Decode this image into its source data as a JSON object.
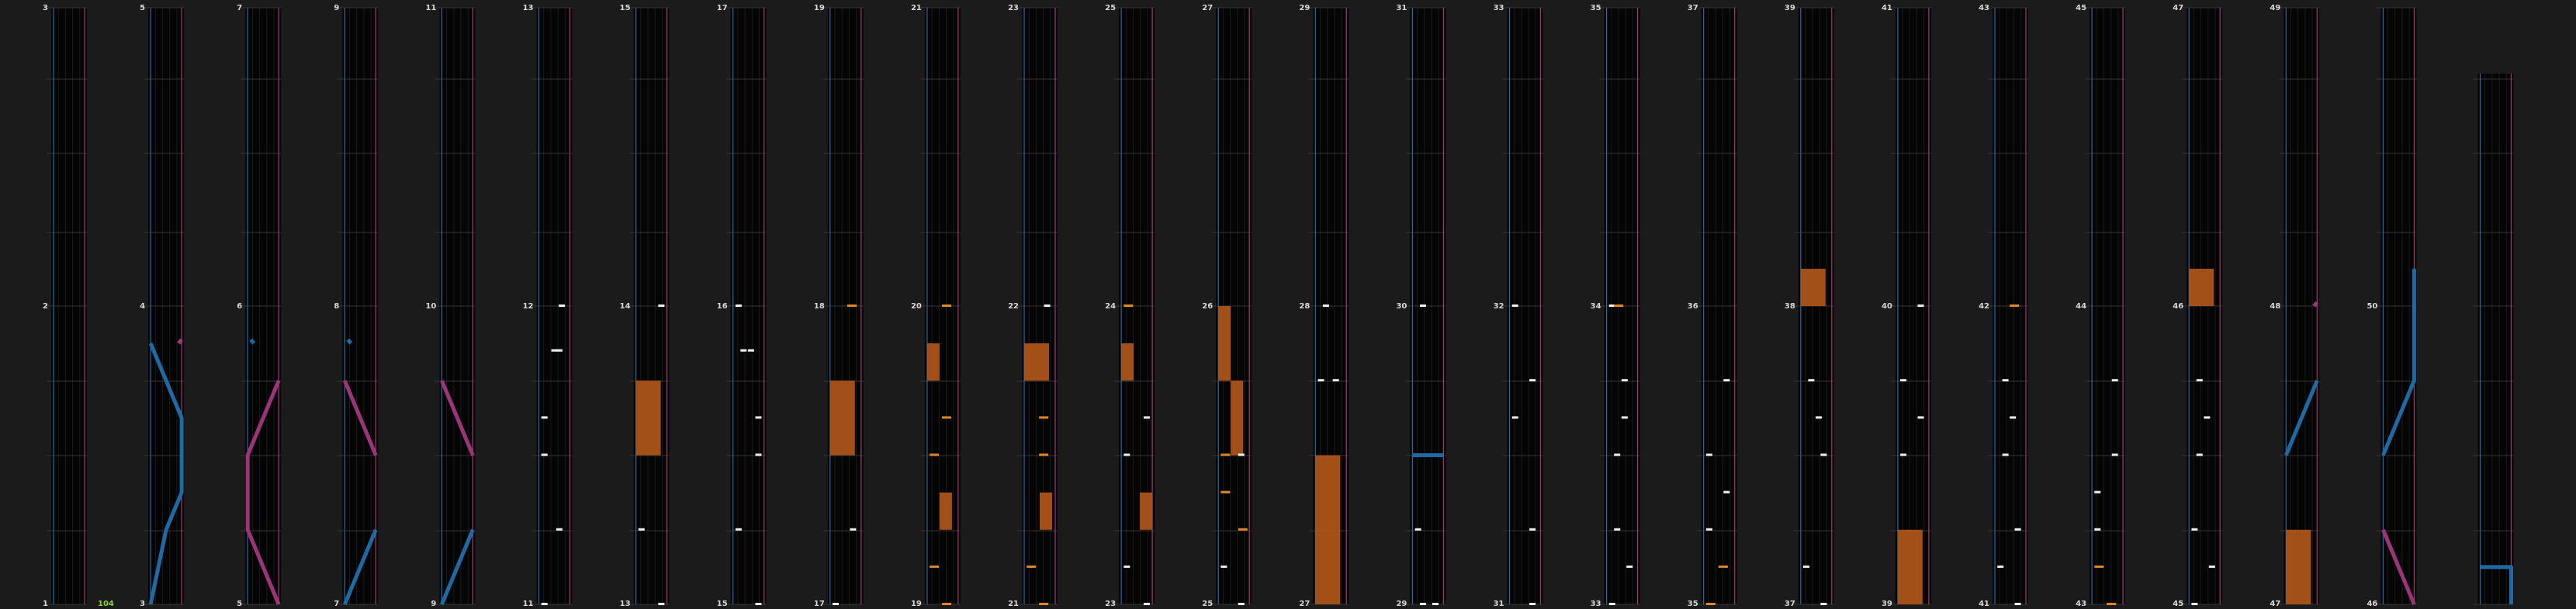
{
  "colors": {
    "background": "#1b1b1b",
    "lane": "#050505",
    "beat_line": "#343434",
    "left_guide": "#2a6aa8",
    "right_guide": "#a83a78",
    "left_slider": "#1f6aa5",
    "right_slider": "#9b3478",
    "hold": "#b0561a",
    "note": "#f0f0f0",
    "mine": "#e08828",
    "label": "#d8d8d8",
    "counter": "#8fd13a"
  },
  "counter_text": "104",
  "row_labels": {
    "bottom": [
      "1",
      "3",
      "5",
      "7",
      "9",
      "11",
      "13",
      "15",
      "17",
      "19",
      "21",
      "23",
      "25",
      "27",
      "29",
      "31",
      "33",
      "35",
      "35",
      "37",
      "39",
      "41",
      "43",
      "45",
      "47",
      "46"
    ],
    "middle": [
      "2",
      "4",
      "6",
      "8",
      "10",
      "12",
      "14",
      "16",
      "18",
      "20",
      "22",
      "24",
      "26",
      "28",
      "30",
      "32",
      "34",
      "36",
      "38",
      "40",
      "42",
      "44",
      "46",
      "48",
      "50"
    ],
    "top": [
      "3",
      "5",
      "7",
      "9",
      "11",
      "13",
      "15",
      "17",
      "19",
      "21",
      "23",
      "25",
      "27",
      "29",
      "31",
      "33",
      "35",
      "37",
      "39",
      "41",
      "43",
      "45",
      "47",
      "49"
    ]
  },
  "chart_data": {
    "type": "other",
    "lane_slots": 5,
    "columns": [
      {
        "label_bottom": "1",
        "label_middle": "2",
        "label_top": "3"
      },
      {
        "label_bottom": "3",
        "label_middle": "4",
        "label_top": "5",
        "left_slider": [
          [
            0,
            0.0
          ],
          [
            1,
            0.25
          ],
          [
            2,
            0.5
          ],
          [
            3,
            1.0
          ],
          [
            4,
            1.0
          ],
          [
            5,
            1.0
          ],
          [
            6,
            0.5
          ],
          [
            7,
            0.0
          ]
        ],
        "right_slider": [
          [
            7,
            0.9
          ],
          [
            7.1,
            1.0
          ]
        ]
      },
      {
        "label_bottom": "5",
        "label_middle": "6",
        "label_top": "7",
        "right_slider": [
          [
            0,
            1.0
          ],
          [
            1,
            0.5
          ],
          [
            2,
            0.0
          ],
          [
            3,
            0.0
          ],
          [
            4,
            0.0
          ],
          [
            5,
            0.5
          ],
          [
            6,
            1.0
          ]
        ],
        "left_slider": [
          [
            7.0,
            0.2
          ],
          [
            7.1,
            0.1
          ]
        ]
      },
      {
        "label_bottom": "7",
        "label_middle": "8",
        "label_top": "9",
        "left_slider": [
          [
            0,
            0.0
          ],
          [
            2,
            1.0
          ]
        ],
        "right_slider": [
          [
            4,
            1.0
          ],
          [
            6,
            0.0
          ]
        ],
        "left_slider2": [
          [
            7.0,
            0.2
          ],
          [
            7.1,
            0.1
          ]
        ]
      },
      {
        "label_bottom": "9",
        "label_middle": "10",
        "label_top": "11",
        "left_slider": [
          [
            0,
            0.0
          ],
          [
            2,
            1.0
          ]
        ],
        "right_slider": [
          [
            4,
            1.0
          ],
          [
            6,
            0.0
          ]
        ]
      },
      {
        "label_bottom": "11",
        "label_middle": "12",
        "label_top": "13",
        "notes": [
          [
            0,
            0.1
          ],
          [
            2,
            0.7
          ],
          [
            4,
            0.1
          ],
          [
            5,
            0.1
          ],
          [
            6.8,
            0.5
          ],
          [
            6.8,
            0.7
          ],
          [
            8,
            0.8
          ]
        ]
      },
      {
        "label_bottom": "13",
        "label_middle": "14",
        "label_top": "15",
        "notes": [
          [
            0,
            0.9
          ],
          [
            2,
            0.1
          ],
          [
            8,
            0.9
          ]
        ],
        "holds": [
          [
            4,
            6,
            0.0,
            0.8
          ]
        ]
      },
      {
        "label_bottom": "15",
        "label_middle": "16",
        "label_top": "17",
        "notes": [
          [
            0,
            0.9
          ],
          [
            2,
            0.1
          ],
          [
            4,
            0.9
          ],
          [
            5,
            0.9
          ],
          [
            6.8,
            0.3
          ],
          [
            6.8,
            0.6
          ],
          [
            8,
            0.1
          ]
        ]
      },
      {
        "label_bottom": "17",
        "label_middle": "18",
        "label_top": "19",
        "notes": [
          [
            0,
            0.1
          ],
          [
            2,
            0.8
          ],
          [
            8,
            0.7
          ]
        ],
        "holds": [
          [
            4,
            6,
            0.0,
            0.8
          ]
        ],
        "mines": [
          [
            8,
            0.7
          ]
        ]
      },
      {
        "label_bottom": "19",
        "label_middle": "20",
        "label_top": "21",
        "mines": [
          [
            0,
            0.6
          ],
          [
            1,
            0.1
          ],
          [
            4,
            0.1
          ],
          [
            5,
            0.6
          ],
          [
            8,
            0.6
          ]
        ],
        "holds": [
          [
            2,
            3,
            0.4,
            0.4
          ],
          [
            6,
            7,
            0.0,
            0.4
          ]
        ]
      },
      {
        "label_bottom": "21",
        "label_middle": "22",
        "label_top": "23",
        "mines": [
          [
            0,
            0.6
          ],
          [
            1,
            0.1
          ],
          [
            4,
            0.6
          ],
          [
            5,
            0.6
          ]
        ],
        "holds": [
          [
            2,
            3,
            0.5,
            0.4
          ],
          [
            6,
            7,
            0.0,
            0.8
          ]
        ],
        "notes": [
          [
            8,
            0.8
          ]
        ]
      },
      {
        "label_bottom": "23",
        "label_middle": "24",
        "label_top": "25",
        "notes": [
          [
            0,
            0.9
          ],
          [
            1,
            0.1
          ],
          [
            4,
            0.1
          ],
          [
            5,
            0.9
          ]
        ],
        "holds": [
          [
            2,
            3,
            0.6,
            0.4
          ],
          [
            6,
            7,
            0.0,
            0.4
          ]
        ],
        "mines": [
          [
            8,
            0.1
          ]
        ]
      },
      {
        "label_bottom": "25",
        "label_middle": "26",
        "label_top": "27",
        "notes": [
          [
            0,
            0.8
          ],
          [
            1,
            0.1
          ],
          [
            4,
            0.8
          ]
        ],
        "mines": [
          [
            2,
            0.8
          ],
          [
            3,
            0.1
          ],
          [
            4,
            0.1
          ]
        ],
        "holds": [
          [
            4,
            6,
            0.4,
            0.4
          ],
          [
            6,
            8,
            0.0,
            0.4
          ]
        ]
      },
      {
        "label_bottom": "27",
        "label_middle": "28",
        "label_top": "29",
        "holds": [
          [
            0,
            4,
            0.0,
            0.8
          ]
        ],
        "notes": [
          [
            6,
            0.1
          ],
          [
            6,
            0.7
          ],
          [
            8,
            0.3
          ]
        ]
      },
      {
        "label_bottom": "29",
        "label_middle": "30",
        "label_top": "31",
        "notes": [
          [
            0,
            0.3
          ],
          [
            0,
            0.8
          ],
          [
            2,
            0.1
          ],
          [
            8,
            0.3
          ]
        ],
        "left_slider": [
          [
            4,
            0.0
          ],
          [
            4,
            1.0
          ]
        ]
      },
      {
        "label_bottom": "31",
        "label_middle": "32",
        "label_top": "33",
        "notes": [
          [
            0,
            0.8
          ],
          [
            2,
            0.8
          ],
          [
            5,
            0.1
          ],
          [
            8,
            0.1
          ],
          [
            6,
            0.8
          ]
        ]
      },
      {
        "label_bottom": "33",
        "label_middle": "34",
        "label_top": "35",
        "notes": [
          [
            0,
            0.1
          ],
          [
            1,
            0.8
          ],
          [
            2,
            0.3
          ],
          [
            4,
            0.3
          ],
          [
            5,
            0.6
          ],
          [
            6,
            0.6
          ],
          [
            8,
            0.1
          ]
        ],
        "mines": [
          [
            8,
            0.3
          ]
        ]
      },
      {
        "label_bottom": "35",
        "label_middle": "36",
        "label_top": "37",
        "notes": [
          [
            0,
            0.1
          ],
          [
            2,
            0.1
          ],
          [
            3,
            0.8
          ],
          [
            4,
            0.1
          ],
          [
            6,
            0.8
          ]
        ],
        "mines": [
          [
            0,
            0.1
          ],
          [
            1,
            0.6
          ]
        ]
      },
      {
        "label_bottom": "37",
        "label_middle": "38",
        "label_top": "39",
        "notes": [
          [
            0,
            0.8
          ],
          [
            1,
            0.1
          ],
          [
            4,
            0.8
          ],
          [
            5,
            0.6
          ],
          [
            6,
            0.3
          ]
        ],
        "holds": [
          [
            8,
            9,
            0.0,
            0.8
          ]
        ]
      },
      {
        "label_bottom": "39",
        "label_middle": "40",
        "label_top": "41",
        "notes": [
          [
            4,
            0.1
          ],
          [
            6,
            0.1
          ],
          [
            5,
            0.8
          ],
          [
            8,
            0.8
          ]
        ],
        "holds": [
          [
            0,
            2,
            0.0,
            0.8
          ]
        ]
      },
      {
        "label_bottom": "41",
        "label_middle": "42",
        "label_top": "43",
        "notes": [
          [
            0,
            0.8
          ],
          [
            1,
            0.1
          ],
          [
            2,
            0.8
          ],
          [
            4,
            0.3
          ],
          [
            5,
            0.6
          ],
          [
            6,
            0.3
          ]
        ],
        "mines": [
          [
            8,
            0.6
          ]
        ]
      },
      {
        "label_bottom": "43",
        "label_middle": "44",
        "label_top": "45",
        "notes": [
          [
            0,
            0.6
          ],
          [
            2,
            0.1
          ],
          [
            3,
            0.1
          ],
          [
            4,
            0.8
          ],
          [
            6,
            0.8
          ]
        ],
        "mines": [
          [
            1,
            0.1
          ],
          [
            0,
            0.6
          ]
        ]
      },
      {
        "label_bottom": "45",
        "label_middle": "46",
        "label_top": "47",
        "notes": [
          [
            0,
            0.1
          ],
          [
            1,
            0.8
          ],
          [
            2,
            0.1
          ],
          [
            4,
            0.3
          ],
          [
            5,
            0.6
          ],
          [
            6,
            0.3
          ]
        ],
        "holds": [
          [
            8,
            9,
            0.0,
            0.8
          ]
        ]
      },
      {
        "label_bottom": "47",
        "label_middle": "48",
        "label_top": "49",
        "holds": [
          [
            0,
            2,
            0.0,
            0.8
          ]
        ],
        "right_slider": [
          [
            8,
            0.9
          ],
          [
            8.1,
            1.0
          ]
        ],
        "left_slider": [
          [
            4,
            0.0
          ],
          [
            6,
            1.0
          ]
        ]
      },
      {
        "label_bottom": "46",
        "label_middle": "50",
        "label_top": "",
        "right_slider": [
          [
            0,
            1.0
          ],
          [
            2,
            0.0
          ]
        ],
        "left_slider": [
          [
            4,
            0.0
          ],
          [
            6,
            1.0
          ],
          [
            8,
            1.0
          ],
          [
            9,
            1.0
          ]
        ]
      },
      {
        "label_bottom": "",
        "label_middle": "",
        "label_top": "",
        "left_slider": [
          [
            0,
            1.0
          ],
          [
            1,
            1.0
          ],
          [
            1,
            0.0
          ]
        ]
      }
    ]
  }
}
